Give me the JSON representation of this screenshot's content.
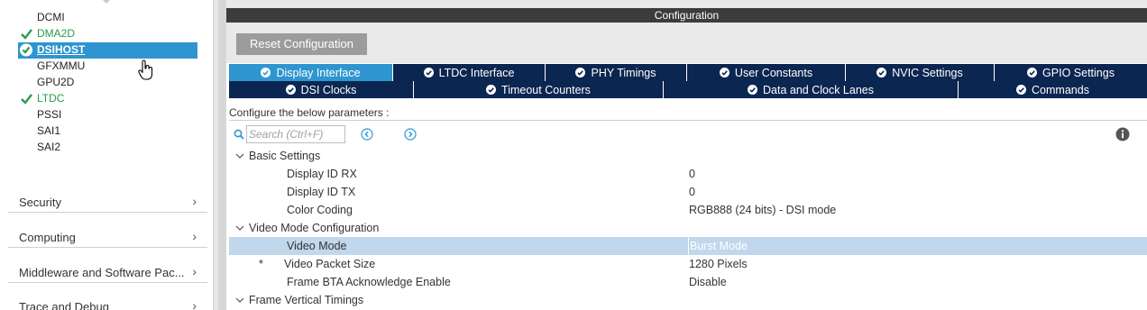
{
  "sidebar": {
    "peripherals": [
      {
        "label": "DCMI",
        "enabled": false,
        "selected": false
      },
      {
        "label": "DMA2D",
        "enabled": true,
        "selected": false
      },
      {
        "label": "DSIHOST",
        "enabled": true,
        "selected": true
      },
      {
        "label": "GFXMMU",
        "enabled": false,
        "selected": false
      },
      {
        "label": "GPU2D",
        "enabled": false,
        "selected": false
      },
      {
        "label": "LTDC",
        "enabled": true,
        "selected": false
      },
      {
        "label": "PSSI",
        "enabled": false,
        "selected": false
      },
      {
        "label": "SAI1",
        "enabled": false,
        "selected": false
      },
      {
        "label": "SAI2",
        "enabled": false,
        "selected": false
      }
    ],
    "categories": [
      {
        "label": "Security",
        "icon": "chevron-right-icon"
      },
      {
        "label": "Computing",
        "icon": "chevron-right-icon"
      },
      {
        "label": "Middleware and Software Pac...",
        "icon": "chevron-right-icon"
      },
      {
        "label": "Trace and Debug",
        "icon": "chevron-right-icon"
      }
    ]
  },
  "panel": {
    "title": "Configuration",
    "reset_label": "Reset Configuration",
    "tabs_row1": [
      {
        "label": "Display Interface",
        "active": true
      },
      {
        "label": "LTDC Interface",
        "active": false
      },
      {
        "label": "PHY Timings",
        "active": false
      },
      {
        "label": "User Constants",
        "active": false
      },
      {
        "label": "NVIC Settings",
        "active": false
      },
      {
        "label": "GPIO Settings",
        "active": false
      }
    ],
    "tabs_row2": [
      {
        "label": "DSI Clocks",
        "active": false
      },
      {
        "label": "Timeout Counters",
        "active": false
      },
      {
        "label": "Data and Clock Lanes",
        "active": false
      },
      {
        "label": "Commands",
        "active": false
      }
    ],
    "params_label": "Configure the below parameters :",
    "search_placeholder": "Search (Ctrl+F)",
    "parameters": [
      {
        "kind": "section",
        "name": "Basic Settings"
      },
      {
        "kind": "param",
        "name": "Display ID RX",
        "value": "0"
      },
      {
        "kind": "param",
        "name": "Display ID TX",
        "value": "0"
      },
      {
        "kind": "param",
        "name": "Color Coding",
        "value": "RGB888 (24 bits) - DSI mode"
      },
      {
        "kind": "section",
        "name": "Video Mode Configuration"
      },
      {
        "kind": "param",
        "name": "Video Mode",
        "value": "Burst Mode",
        "highlighted": true
      },
      {
        "kind": "param",
        "name": "Video Packet Size",
        "value": "1280 Pixels",
        "marker": "*"
      },
      {
        "kind": "param",
        "name": "Frame BTA Acknowledge Enable",
        "value": "Disable"
      },
      {
        "kind": "section",
        "name": "Frame Vertical Timings"
      }
    ]
  },
  "colors": {
    "accent": "#2f95d0",
    "tab_bg": "#0b2650",
    "enabled_green": "#2a9b4a",
    "header_bg": "#3c3c3c",
    "highlight_row": "#c0d7ec"
  }
}
